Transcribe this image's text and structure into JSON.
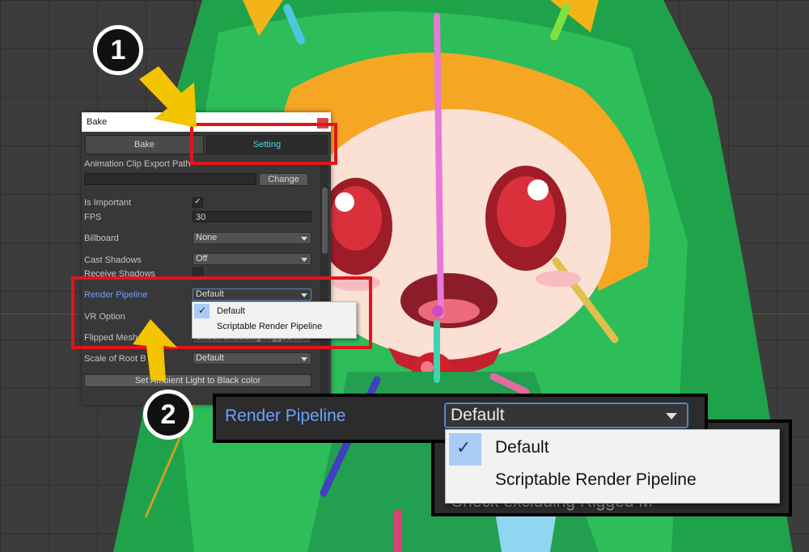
{
  "window": {
    "title": "Bake",
    "tabs": [
      {
        "label": "Bake",
        "active": false
      },
      {
        "label": "Setting",
        "active": true
      }
    ],
    "animation_clip_export_path": {
      "label": "Animation Clip Export Path",
      "value": "",
      "button": "Change"
    },
    "is_important": {
      "label": "Is Important",
      "checked": true,
      "check_glyph": "✓"
    },
    "fps": {
      "label": "FPS",
      "value": "30"
    },
    "billboard": {
      "label": "Billboard",
      "value": "None"
    },
    "cast_shadows": {
      "label": "Cast Shadows",
      "value": "Off"
    },
    "receive_shadows": {
      "label": "Receive Shadows",
      "checked": false
    },
    "render_pipeline": {
      "label": "Render Pipeline",
      "value": "Default"
    },
    "vr_option": {
      "label": "VR Option"
    },
    "flipped_mesh": {
      "label": "Flipped Mesh",
      "value": "Check excluding Rigged M"
    },
    "scale_of_root_bone": {
      "label": "Scale of Root B",
      "value": "Default"
    },
    "ambient_button": "Set Ambient Light to Black color",
    "popup": {
      "options": [
        "Default",
        "Scriptable Render Pipeline"
      ],
      "selected": 0,
      "check_glyph": "✓"
    }
  },
  "zoom": {
    "label": "Render Pipeline",
    "value": "Default",
    "options": [
      "Default",
      "Scriptable Render Pipeline"
    ],
    "selected": 0,
    "check_glyph": "✓",
    "ghost_text": "Check excluding Rigged M"
  },
  "annotations": {
    "step1": "1",
    "step2": "2",
    "arrow_color": "#f5c400",
    "highlight_color": "#e0151a"
  }
}
